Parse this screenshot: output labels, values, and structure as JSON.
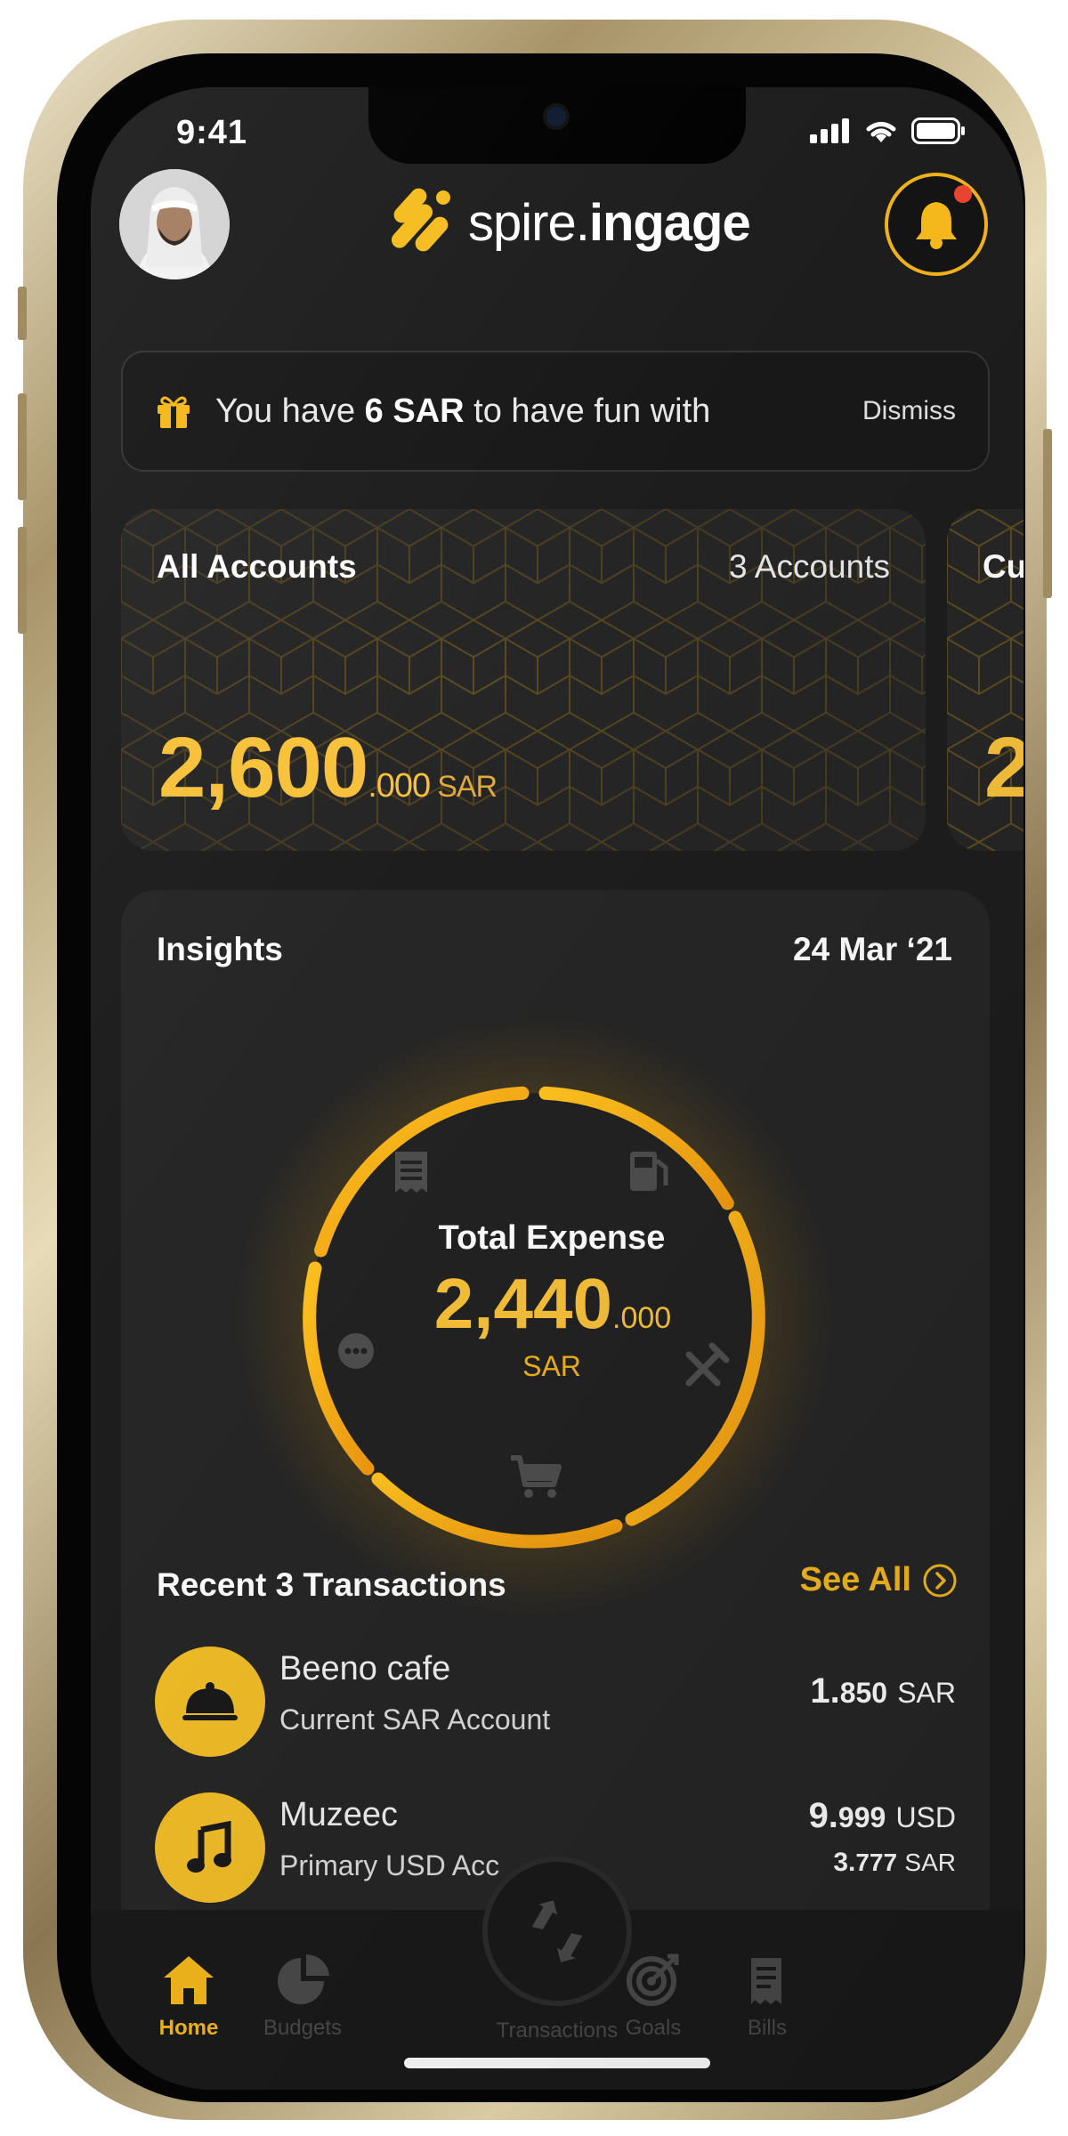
{
  "status_bar": {
    "time": "9:41"
  },
  "header": {
    "logo_light": "spire.",
    "logo_bold": "ingage"
  },
  "promo": {
    "prefix": "You have ",
    "amount": "6 SAR",
    "suffix": " to have fun with",
    "dismiss_label": "Dismiss"
  },
  "accounts": [
    {
      "title": "All Accounts",
      "count": "3 Accounts",
      "amount": "2,600",
      "decimals": ".000",
      "currency": "SAR"
    },
    {
      "title": "Cu",
      "count": "",
      "amount": "2",
      "decimals": "",
      "currency": ""
    }
  ],
  "insights": {
    "title": "Insights",
    "date": "24 Mar ‘21",
    "total_label": "Total Expense",
    "total_amount": "2,440",
    "total_decimals": ".000",
    "total_currency": "SAR",
    "category_icons": [
      "receipt-icon",
      "fuel-icon",
      "dining-icon",
      "cart-icon",
      "more-icon"
    ]
  },
  "transactions": {
    "header": "Recent 3 Transactions",
    "see_all_label": "See All",
    "items": [
      {
        "icon": "cloche-icon",
        "name": "Beeno cafe",
        "account": "Current SAR Account",
        "amount_int": "1.",
        "amount_dec": "850",
        "currency": "SAR"
      },
      {
        "icon": "music-note-icon",
        "name": "Muzeec",
        "account": "Primary USD Acc",
        "amount_int": "9.",
        "amount_dec": "999",
        "currency": "USD",
        "alt_amount_int": "3.",
        "alt_amount_dec": "777",
        "alt_currency": "SAR"
      }
    ]
  },
  "tabbar": {
    "active": "Home",
    "tabs": [
      "Home",
      "Budgets",
      "Transactions",
      "Goals",
      "Bills"
    ]
  },
  "colors": {
    "accent": "#f5b81c",
    "amount_gold": "#f7c13a",
    "background": "#1d1d1d",
    "card": "#262626",
    "notification_dot": "#e8452f"
  }
}
